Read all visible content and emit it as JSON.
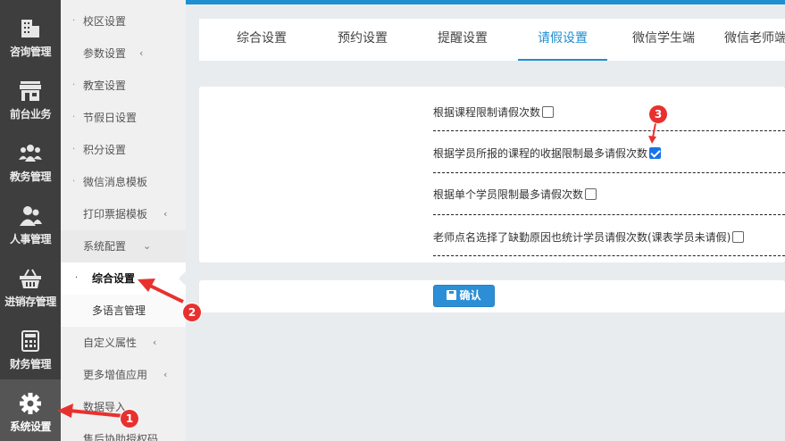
{
  "leftnav": {
    "items": [
      {
        "label": "咨询管理",
        "icon": "building-icon"
      },
      {
        "label": "前台业务",
        "icon": "storefront-icon"
      },
      {
        "label": "教务管理",
        "icon": "group-icon"
      },
      {
        "label": "人事管理",
        "icon": "users-icon"
      },
      {
        "label": "进销存管理",
        "icon": "basket-icon"
      },
      {
        "label": "财务管理",
        "icon": "calculator-icon"
      },
      {
        "label": "系统设置",
        "icon": "gear-icon"
      }
    ]
  },
  "submenu": {
    "items": [
      {
        "label": "校区设置"
      },
      {
        "label": "参数设置"
      },
      {
        "label": "教室设置"
      },
      {
        "label": "节假日设置"
      },
      {
        "label": "积分设置"
      },
      {
        "label": "微信消息模板"
      },
      {
        "label": "打印票据模板"
      },
      {
        "label": "系统配置"
      },
      {
        "label": "综合设置"
      },
      {
        "label": "多语言管理"
      },
      {
        "label": "自定义属性"
      },
      {
        "label": "更多增值应用"
      },
      {
        "label": "数据导入"
      },
      {
        "label": "售后协助授权码"
      }
    ]
  },
  "tabs": [
    {
      "label": "综合设置"
    },
    {
      "label": "预约设置"
    },
    {
      "label": "提醒设置"
    },
    {
      "label": "请假设置"
    },
    {
      "label": "微信学生端"
    },
    {
      "label": "微信老师端"
    }
  ],
  "leave_settings": {
    "options": [
      {
        "label": "根据课程限制请假次数",
        "checked": false
      },
      {
        "label": "根据学员所报的课程的收据限制最多请假次数",
        "checked": true
      },
      {
        "label": "根据单个学员限制最多请假次数",
        "checked": false
      },
      {
        "label": "老师点名选择了缺勤原因也统计学员请假次数(课表学员未请假)",
        "checked": false
      }
    ],
    "confirm_label": "确认"
  },
  "annotations": {
    "badge1": "1",
    "badge2": "2",
    "badge3": "3"
  },
  "colors": {
    "accent": "#1e8fd0",
    "nav_bg": "#3e3e3e",
    "annotation": "#e8312f"
  }
}
